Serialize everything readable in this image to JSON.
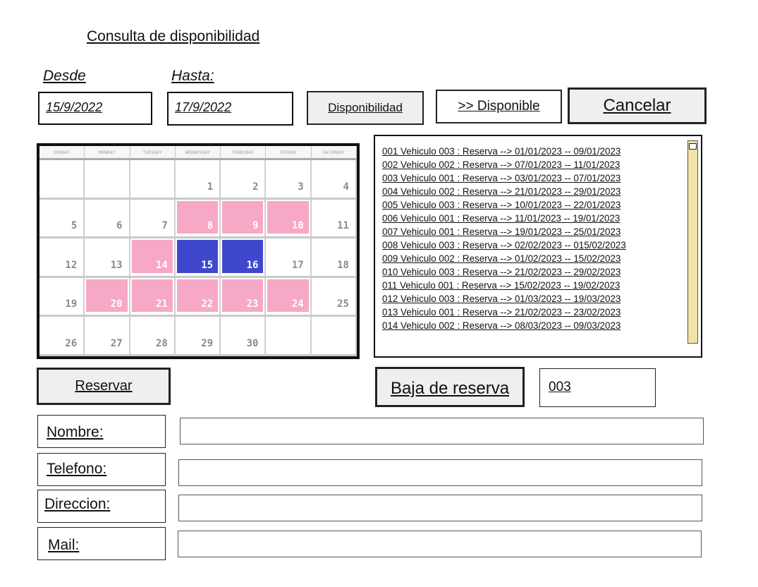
{
  "page": {
    "title": "Consulta de disponibilidad"
  },
  "range": {
    "from_label": "Desde",
    "to_label": "Hasta:",
    "from_value": "15/9/2022",
    "to_value": "17/9/2022"
  },
  "buttons": {
    "availability": "Disponibilidad",
    "available": ">> Disponible",
    "cancel": "Cancelar",
    "reserve": "Reservar",
    "cancel_reservation": "Baja de reserva"
  },
  "reservation_id": "003",
  "calendar": {
    "weekdays": [
      "SUNDAY",
      "MONDAY",
      "TUESDAY",
      "WEDNESDAY",
      "THURSDAY",
      "FRIDAY",
      "SATURDAY"
    ],
    "days": [
      {
        "n": "",
        "s": ""
      },
      {
        "n": "",
        "s": ""
      },
      {
        "n": "",
        "s": ""
      },
      {
        "n": "1",
        "s": ""
      },
      {
        "n": "2",
        "s": ""
      },
      {
        "n": "3",
        "s": ""
      },
      {
        "n": "4",
        "s": ""
      },
      {
        "n": "5",
        "s": ""
      },
      {
        "n": "6",
        "s": ""
      },
      {
        "n": "7",
        "s": ""
      },
      {
        "n": "8",
        "s": "pink"
      },
      {
        "n": "9",
        "s": "pink"
      },
      {
        "n": "10",
        "s": "pink"
      },
      {
        "n": "11",
        "s": ""
      },
      {
        "n": "12",
        "s": ""
      },
      {
        "n": "13",
        "s": ""
      },
      {
        "n": "14",
        "s": "pink"
      },
      {
        "n": "15",
        "s": "blue"
      },
      {
        "n": "16",
        "s": "blue"
      },
      {
        "n": "17",
        "s": ""
      },
      {
        "n": "18",
        "s": ""
      },
      {
        "n": "19",
        "s": ""
      },
      {
        "n": "20",
        "s": "pink"
      },
      {
        "n": "21",
        "s": "pink"
      },
      {
        "n": "22",
        "s": "pink"
      },
      {
        "n": "23",
        "s": "pink"
      },
      {
        "n": "24",
        "s": "pink"
      },
      {
        "n": "25",
        "s": ""
      },
      {
        "n": "26",
        "s": ""
      },
      {
        "n": "27",
        "s": ""
      },
      {
        "n": "28",
        "s": ""
      },
      {
        "n": "29",
        "s": ""
      },
      {
        "n": "30",
        "s": ""
      },
      {
        "n": "",
        "s": ""
      },
      {
        "n": "",
        "s": ""
      }
    ],
    "colors": {
      "reserved": "#f7a8c6",
      "selected": "#3f48cc"
    }
  },
  "reservations": [
    "001 Vehiculo 003 : Reserva --> 01/01/2023 -- 09/01/2023",
    "002 Vehiculo 002 : Reserva --> 07/01/2023 -- 11/01/2023",
    "003 Vehiculo 001 : Reserva --> 03/01/2023 -- 07/01/2023",
    "004 Vehiculo 002 : Reserva --> 21/01/2023 -- 29/01/2023",
    "005 Vehiculo 003 : Reserva --> 10/01/2023 -- 22/01/2023",
    "006 Vehiculo 001 : Reserva --> 11/01/2023 -- 19/01/2023",
    "007 Vehiculo 001 : Reserva --> 19/01/2023 -- 25/01/2023",
    "008 Vehiculo 003 : Reserva --> 02/02/2023 -- 015/02/2023",
    "009 Vehiculo 002 : Reserva --> 01/02/2023 -- 15/02/2023",
    "010 Vehiculo 003 : Reserva --> 21/02/2023 -- 29/02/2023",
    "011 Vehiculo 001 : Reserva --> 15/02/2023 -- 19/02/2023",
    "012 Vehiculo 003 : Reserva --> 01/03/2023 -- 19/03/2023",
    "013 Vehiculo 001 : Reserva --> 21/02/2023 -- 23/02/2023",
    "014 Vehiculo 002 : Reserva --> 08/03/2023 -- 09/03/2023"
  ],
  "form": {
    "name_label": "Nombre:",
    "phone_label": "Telefono:",
    "address_label": "Direccion:",
    "mail_label": "Mail:"
  }
}
